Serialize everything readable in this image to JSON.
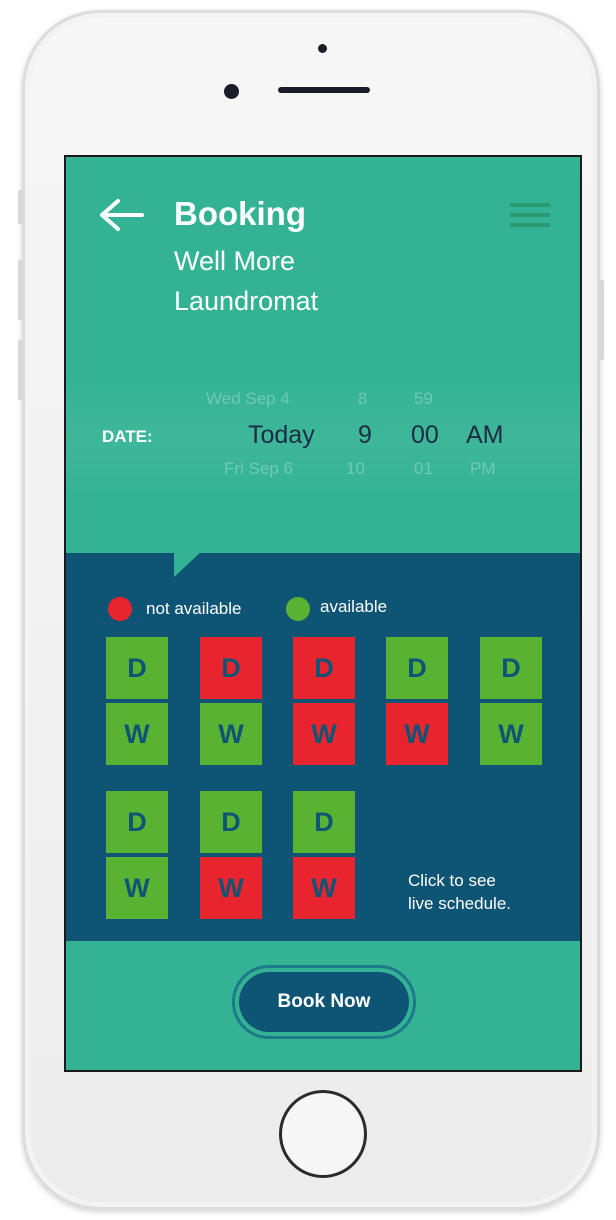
{
  "header": {
    "title": "Booking",
    "subtitle_line1": "Well More",
    "subtitle_line2": "Laundromat",
    "back_icon": "arrow-left-icon",
    "menu_icon": "hamburger-menu-icon"
  },
  "picker": {
    "label": "DATE:",
    "day": [
      "Wed Sep 4",
      "Today",
      "Fri Sep 6"
    ],
    "hour": [
      "8",
      "9",
      "10"
    ],
    "minute": [
      "59",
      "00",
      "01"
    ],
    "ampm": [
      "",
      "AM",
      "PM"
    ]
  },
  "legend": {
    "not_available": "not available",
    "available": "available"
  },
  "machines": {
    "columns": [
      {
        "D": "D",
        "W": "W",
        "D_status": "available",
        "W_status": "available"
      },
      {
        "D": "D",
        "W": "W",
        "D_status": "not available",
        "W_status": "available"
      },
      {
        "D": "D",
        "W": "W",
        "D_status": "not available",
        "W_status": "not available"
      },
      {
        "D": "D",
        "W": "W",
        "D_status": "available",
        "W_status": "not available"
      },
      {
        "D": "D",
        "W": "W",
        "D_status": "available",
        "W_status": "available"
      },
      {
        "D": "D",
        "W": "W",
        "D_status": "available",
        "W_status": "available"
      },
      {
        "D": "D",
        "W": "W",
        "D_status": "available",
        "W_status": "not available"
      },
      {
        "D": "D",
        "W": "W",
        "D_status": "available",
        "W_status": "not available"
      }
    ]
  },
  "schedule_hint": {
    "line1": "Click to see",
    "line2": "live schedule."
  },
  "actions": {
    "book_now": "Book Now"
  },
  "colors": {
    "teal": "#34b394",
    "navy": "#0e5575",
    "available": "#5ab232",
    "not_available": "#e8242e"
  }
}
